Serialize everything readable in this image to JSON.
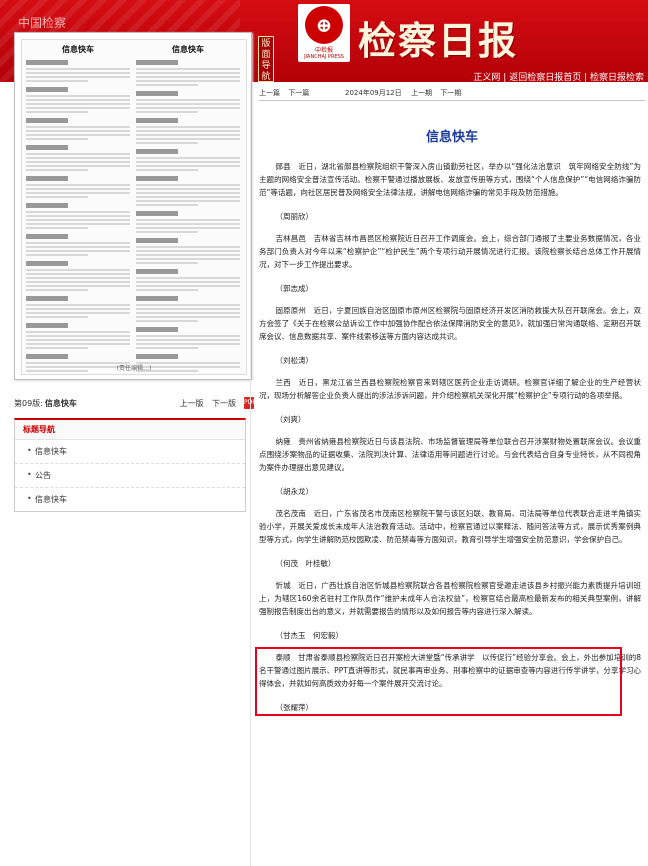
{
  "header": {
    "site_name": "中国检察",
    "nav_badge": "版面导航",
    "logo_caption": "中检报",
    "logo_en": "JIANCHAJ PRESS",
    "masthead": "检察日报",
    "top_links": [
      "正义网",
      "返回检察日报首页",
      "检察日报检索"
    ]
  },
  "colors": {
    "banner_red": "#c8070d",
    "title_blue": "#1c3c9c",
    "highlight_red": "#e8001e"
  },
  "thumbnail": {
    "left_title": "信息快车",
    "right_title": "信息快车",
    "footer": "(责任编辑…)"
  },
  "version_bar": {
    "label": "第09版:",
    "name": "信息快车",
    "prev": "上一版",
    "next": "下一版",
    "pdf": "PDF"
  },
  "title_nav": {
    "heading": "标题导航",
    "items": [
      "信息快车",
      "公告",
      "信息快车"
    ]
  },
  "article_nav": {
    "prev": "上一篇",
    "next": "下一篇",
    "date": "2024年09月12日",
    "prev_issue": "上一期",
    "next_issue": "下一期"
  },
  "article": {
    "title": "信息快车",
    "paragraphs": [
      "郧县　近日，湖北省郧县检察院组织干警深入房山镇勤劳社区，举办以“强化法治意识　筑牢网络安全防线”为主题的网络安全普法宣传活动。检察干警通过播放展板、发放宣传册等方式，围绕“个人信息保护”“电信网络诈骗防范”等话题，向社区居民普及网络安全法律法规，讲解电信网络诈骗的常见手段及防范措施。",
      "（周丽欣）",
      "吉林昌邑　吉林省吉林市昌邑区检察院近日召开工作调度会。会上，综合部门通报了主要业务数据情况，各业务部门负责人对今年以来“检察护企”“检护民生”两个专项行动开展情况进行汇报。该院检察长结合总体工作开展情况，对下一步工作提出要求。",
      "（郭志成）",
      "固原原州　近日，宁夏回族自治区固原市原州区检察院与固原经济开发区消防救援大队召开联席会。会上，双方会签了《关于在检察公益诉讼工作中加强协作配合依法保障消防安全的意见》，就加强日常沟通联络、定期召开联席会议、信息数据共享、案件线索移送等方面内容达成共识。",
      "（刘松涛）",
      "兰西　近日，黑龙江省兰西县检察院检察官来到辖区医药企业走访调研。检察官详细了解企业的生产经营状况，现场分析解答企业负责人提出的涉法涉诉问题，并介绍检察机关深化开展“检察护企”专项行动的各项举措。",
      "（刘爽）",
      "纳雍　贵州省纳雍县检察院近日与该县法院、市场监督管理局等单位联合召开涉案财物处置联席会议。会议重点围绕涉案物品的证据收集、法院判决计算、法律适用等问题进行讨论。与会代表结合自身专业特长，从不同视角为案件办理提出意见建议。",
      "（胡永龙）",
      "茂名茂南　近日，广东省茂名市茂南区检察院干警与该区妇联、教育局、司法局等单位代表联合走进羊角镇实验小学，开展关爱成长未成年人法治教育活动。活动中，检察官通过以案释法、随问答法等方式，展示优秀案例典型等方式，向学生讲解防范校园欺凌、防范禁毒等方面知识，教育引导学生增强安全防范意识，学会保护自己。",
      "（何茂　叶桂敏）",
      "忻城　近日，广西壮族自治区忻城县检察院联合各县检察院检察官受邀走进该县乡村振兴能力素质提升培训班上，为辖区160余名驻村工作队员作“维护未成年人合法权益”，检察官结合最高检最新发布的相关典型案例，讲解强制报告制度出台的意义，并就需要报告的情形以及如何报告等内容进行深入解读。",
      "（甘杰玉　何宏毅）"
    ],
    "highlight_paragraph": "泰顺　甘肃省泰顺县检察院近日召开案检大讲堂暨“传承讲学　以传促行”经验分享会。会上，外出参加培训的8名干警通过图片展示、PPT直讲等形式，就民事再审业务、刑事检察中的证据审查等内容进行传学讲学，分享学习心得体会，并就如何高质效办好每一个案件展开交流讨论。",
    "highlight_author": "（张耀萍）"
  }
}
